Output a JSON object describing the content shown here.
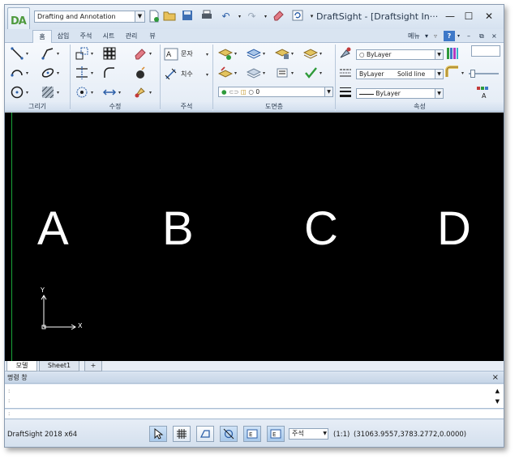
{
  "workspace": {
    "current": "Drafting and Annotation"
  },
  "window": {
    "title": "DraftSight - [Draftsight In···"
  },
  "tabs": [
    "홈",
    "삽입",
    "주석",
    "시트",
    "관리",
    "뷰"
  ],
  "tabbar_right": {
    "menu_label": "메뉴",
    "menu_caret": "▾",
    "help_label": "?"
  },
  "ribbon": {
    "groups": [
      "그리기",
      "수정",
      "주석",
      "도면층",
      "속성"
    ],
    "annotation": {
      "text_label": "문자",
      "dimension_label": "치수"
    },
    "layer_combo": {
      "value": "0"
    },
    "properties": {
      "color": "ByLayer",
      "linetype": "ByLayer",
      "linetype_desc": "Solid line",
      "lineweight": "ByLayer"
    }
  },
  "canvas": {
    "letters": [
      "A",
      "B",
      "C",
      "D"
    ],
    "ucs": {
      "y_label": "Y",
      "x_label": "X"
    },
    "accent_line": "#19a33a",
    "background": "#000000"
  },
  "sheets": {
    "model": "모델",
    "sheet1": "Sheet1",
    "add": "+"
  },
  "command": {
    "title": "명령 창",
    "close": "×",
    "prompt": ":"
  },
  "status": {
    "app": "DraftSight 2018 x64",
    "annotation_scale_mode": "주석",
    "scale": "(1:1)",
    "coordinates": "(31063.9557,3783.2772,0.0000)"
  }
}
